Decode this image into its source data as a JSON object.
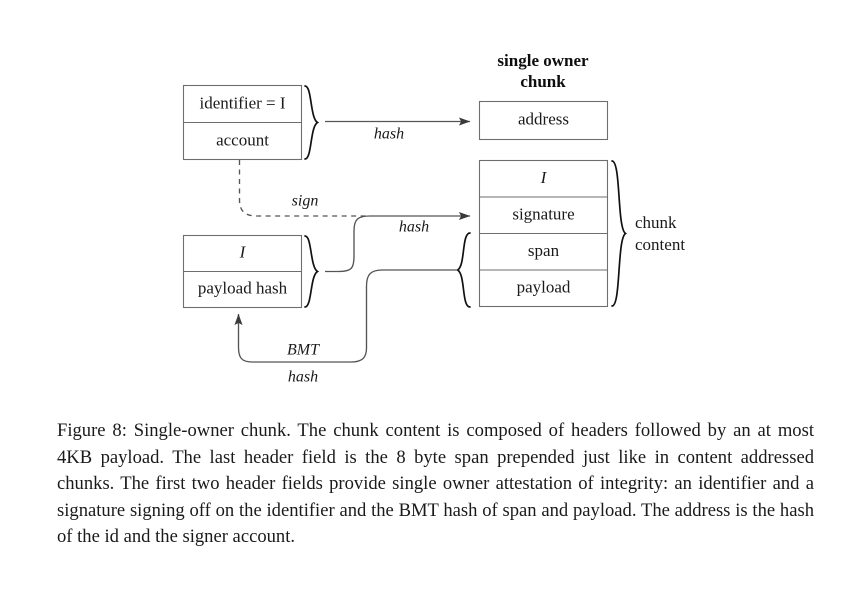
{
  "figure": {
    "caption": "Figure 8: Single-owner chunk. The chunk content is composed of headers followed by an at most 4KB payload. The last header field is the 8 byte span prepended just like in content addressed chunks. The first two header fields provide single owner attestation of integrity: an identifier and a signature signing off on the identifier and the BMT hash of span and payload. The address is the hash of the id and the signer account."
  },
  "diagram": {
    "title": {
      "line1": "single owner",
      "line2": "chunk"
    },
    "id_box": {
      "name": "identifier-account-box",
      "rows": [
        {
          "label": "identifier = I",
          "style": "mixed"
        },
        {
          "label": "account",
          "style": "normal"
        }
      ]
    },
    "payload_box": {
      "name": "identifier-payload-hash-box",
      "rows": [
        {
          "label": "I",
          "style": "italic"
        },
        {
          "label": "payload hash",
          "style": "normal"
        }
      ]
    },
    "address_box": {
      "name": "address-box",
      "rows": [
        {
          "label": "address",
          "style": "normal"
        }
      ]
    },
    "chunk_box": {
      "name": "chunk-content-box",
      "rows": [
        {
          "label": "I",
          "style": "italic"
        },
        {
          "label": "signature",
          "style": "normal"
        },
        {
          "label": "span",
          "style": "normal"
        },
        {
          "label": "payload",
          "style": "normal"
        }
      ]
    },
    "side_label": {
      "line1": "chunk",
      "line2": "content"
    },
    "edges": [
      {
        "name": "hash-address",
        "label": "hash"
      },
      {
        "name": "sign",
        "label": "sign"
      },
      {
        "name": "hash-signature",
        "label": "hash"
      },
      {
        "name": "bmt-hash-line1",
        "label": "BMT"
      },
      {
        "name": "bmt-hash-line2",
        "label": "hash"
      }
    ]
  },
  "colors": {
    "box_stroke": "#6e6e6e",
    "connector": "#555555",
    "brace": "#111111",
    "text": "#1a1a1a",
    "background": "#ffffff"
  }
}
